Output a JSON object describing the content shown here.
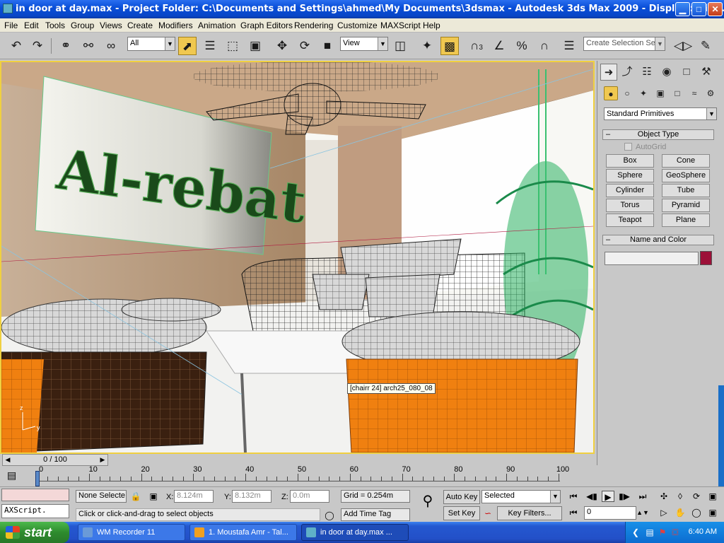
{
  "window": {
    "title": "in door at day.max    - Project Folder: C:\\Documents and Settings\\ahmed\\My Documents\\3dsmax     - Autodesk 3ds Max  2009      - Display : Dire...",
    "minimize": "▁",
    "maximize": "□",
    "close": "✕"
  },
  "menu": [
    "File",
    "Edit",
    "Tools",
    "Group",
    "Views",
    "Create",
    "Modifiers",
    "Animation",
    "Graph Editors",
    "Rendering",
    "Customize",
    "MAXScript",
    "Help"
  ],
  "toolbar": {
    "filter": "All",
    "refcoord": "View",
    "selection_set_placeholder": "Create Selection Set",
    "angle_snap_label": "3"
  },
  "viewport": {
    "label": "",
    "sign_text": "Al-rebat",
    "tooltip": "[chairr 24] arch25_080_08"
  },
  "command_panel": {
    "category": "Standard Primitives",
    "rollout_object_type": "Object Type",
    "autogrid": "AutoGrid",
    "buttons": [
      "Box",
      "Cone",
      "Sphere",
      "GeoSphere",
      "Cylinder",
      "Tube",
      "Torus",
      "Pyramid",
      "Teapot",
      "Plane"
    ],
    "rollout_name_color": "Name and Color",
    "object_name": "",
    "object_color": "#9c1038"
  },
  "timeline": {
    "frame_display": "0 / 100",
    "ticks": [
      0,
      10,
      20,
      30,
      40,
      50,
      60,
      70,
      80,
      90,
      100
    ]
  },
  "status": {
    "script_label": "AXScript.",
    "selection": "None Selecte",
    "x_label": "X:",
    "x_value": "8.124m",
    "y_label": "Y:",
    "y_value": "8.132m",
    "z_label": "Z:",
    "z_value": "0.0m",
    "grid": "Grid = 0.254m",
    "prompt": "Click or click-and-drag to select objects",
    "add_time_tag": "Add Time Tag",
    "auto_key": "Auto Key",
    "set_key": "Set Key",
    "key_mode": "Selected",
    "key_filters": "Key Filters...",
    "current_frame": "0"
  },
  "taskbar": {
    "start": "start",
    "tasks": [
      "WM Recorder 11",
      "1. Moustafa Amr - Tal...",
      "in door at day.max    ..."
    ],
    "clock": "6:40 AM"
  }
}
